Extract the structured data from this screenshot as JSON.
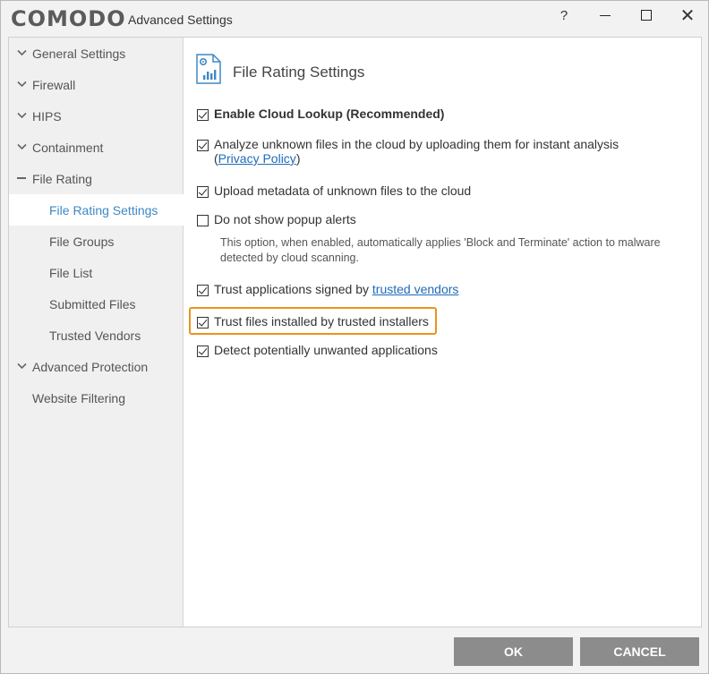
{
  "window": {
    "logo": "COMODO",
    "title": "Advanced Settings",
    "help": "?",
    "close": "✕"
  },
  "sidebar": {
    "items": [
      {
        "label": "General Settings",
        "expander": "chevron-down"
      },
      {
        "label": "Firewall",
        "expander": "chevron-down"
      },
      {
        "label": "HIPS",
        "expander": "chevron-down"
      },
      {
        "label": "Containment",
        "expander": "chevron-down"
      },
      {
        "label": "File Rating",
        "expander": "minus"
      },
      {
        "label": "File Rating Settings",
        "selected": true
      },
      {
        "label": "File Groups"
      },
      {
        "label": "File List"
      },
      {
        "label": "Submitted Files"
      },
      {
        "label": "Trusted Vendors"
      },
      {
        "label": "Advanced Protection",
        "expander": "chevron-down"
      },
      {
        "label": "Website Filtering"
      }
    ]
  },
  "main": {
    "title": "File Rating Settings",
    "options": {
      "cloud_lookup": {
        "label": "Enable Cloud Lookup (Recommended)",
        "checked": true
      },
      "analyze": {
        "label": "Analyze unknown files in the cloud by uploading them for instant analysis",
        "paren_open": "(",
        "link": "Privacy Policy",
        "paren_close": ")",
        "checked": true
      },
      "metadata": {
        "label": "Upload metadata of unknown files to the cloud",
        "checked": true
      },
      "no_popup": {
        "label": "Do not show popup alerts",
        "checked": false,
        "description": "This option, when enabled, automatically applies 'Block and Terminate' action to malware detected by cloud scanning."
      },
      "trust_signed": {
        "label": "Trust applications signed by",
        "link": "trusted vendors",
        "checked": true
      },
      "trust_installers": {
        "label": "Trust files installed by trusted installers",
        "checked": true
      },
      "detect_pua": {
        "label": "Detect potentially unwanted applications",
        "checked": true
      }
    }
  },
  "buttons": {
    "ok": "OK",
    "cancel": "CANCEL"
  },
  "colors": {
    "accent": "#3f88c5",
    "highlight": "#e8941f",
    "button": "#8c8c8c"
  }
}
